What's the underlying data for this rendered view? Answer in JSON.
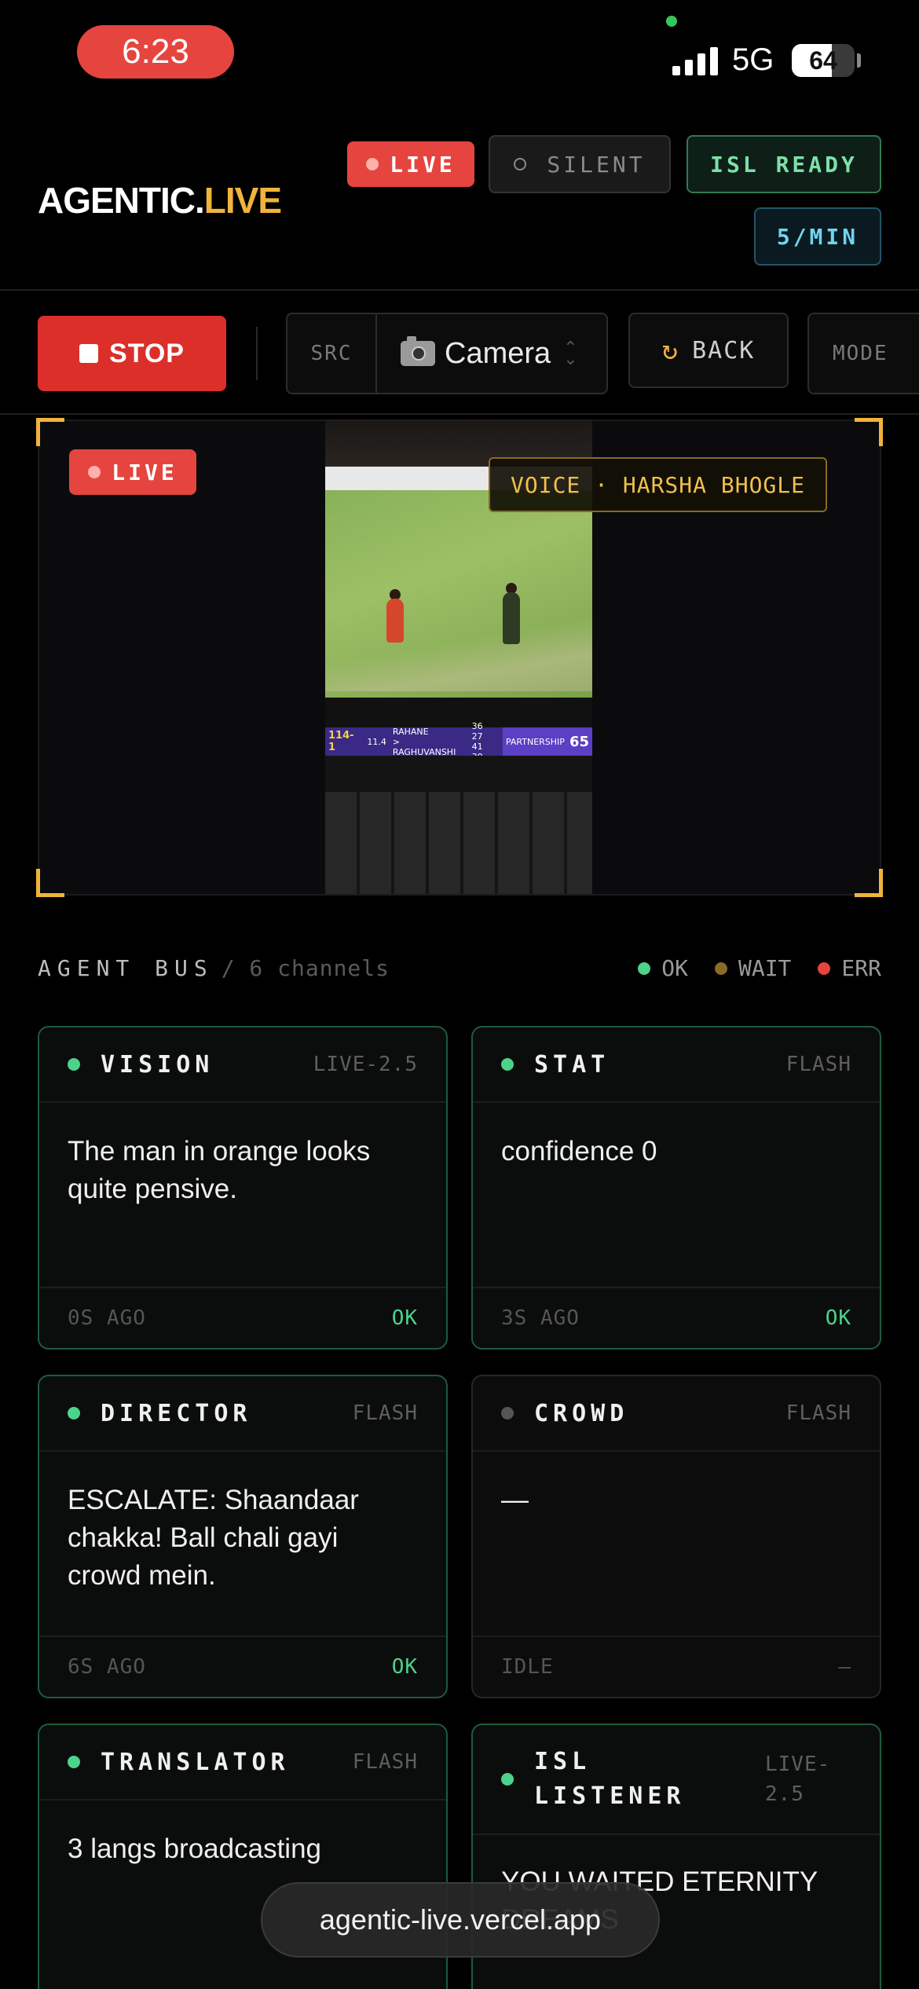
{
  "status_bar": {
    "time": "6:23",
    "network": "5G",
    "battery": "64",
    "battery_level": 0.64
  },
  "header": {
    "logo_main": "AGENTIC.",
    "logo_accent": "LIVE",
    "chips": {
      "live": "LIVE",
      "silent": "SILENT",
      "isl": "ISL READY",
      "rate": "5/MIN"
    }
  },
  "toolbar": {
    "stop_label": "STOP",
    "src_label": "SRC",
    "source_value": "Camera",
    "back_label": "BACK",
    "mode_label": "MODE"
  },
  "stage": {
    "live_label": "LIVE",
    "voice_label": "VOICE · HARSHA BHOGLE",
    "scoreboard": {
      "score": "114-1",
      "overs": "11.4",
      "batter1": "RAHANE",
      "batter1_runs": "36 27",
      "batter2": "> RAGHUVANSHI",
      "batter2_runs": "41 30",
      "partnership_label": "PARTNERSHIP",
      "partnership": "65"
    }
  },
  "agent_bus": {
    "title": "AGENT BUS",
    "subtitle": "/ 6 channels",
    "legend": [
      {
        "label": "OK",
        "color": "#4cd38a"
      },
      {
        "label": "WAIT",
        "color": "#8a6a2a"
      },
      {
        "label": "ERR",
        "color": "#e5443f"
      }
    ],
    "cards": [
      {
        "name": "VISION",
        "model": "LIVE-2.5",
        "body": "The man in orange looks quite pensive.",
        "ago": "0S AGO",
        "state": "OK"
      },
      {
        "name": "STAT",
        "model": "FLASH",
        "body": "confidence 0",
        "ago": "3S AGO",
        "state": "OK"
      },
      {
        "name": "DIRECTOR",
        "model": "FLASH",
        "body": "ESCALATE: Shaandaar chakka! Ball chali gayi crowd mein.",
        "ago": "6S AGO",
        "state": "OK"
      },
      {
        "name": "CROWD",
        "model": "FLASH",
        "body": "—",
        "ago": "IDLE",
        "state": "—"
      },
      {
        "name": "TRANSLATOR",
        "model": "FLASH",
        "body": "3 langs broadcasting",
        "ago": "",
        "state": ""
      },
      {
        "name": "ISL LISTENER",
        "model": "LIVE-2.5",
        "body": "YOU WAITED ETERNITY DREAMS",
        "ago": "",
        "state": ""
      }
    ]
  },
  "url_bar": {
    "url": "agentic-live.vercel.app"
  }
}
